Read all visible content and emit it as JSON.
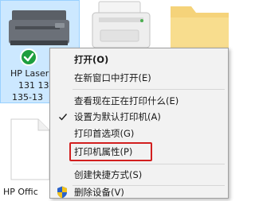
{
  "tiles": {
    "hp": {
      "line1": "HP Laser",
      "line2": "131 13",
      "line3": "135-13"
    },
    "office": {
      "label": "HP Offic"
    }
  },
  "menu": {
    "items": [
      {
        "label": "打开(O)",
        "bold": true
      },
      {
        "label": "在新窗口中打开(E)"
      },
      {
        "label": "查看现在正在打印什么(E)"
      },
      {
        "label": "设置为默认打印机(A)",
        "checked": true
      },
      {
        "label": "打印首选项(G)"
      },
      {
        "label": "打印机属性(P)",
        "highlighted": true
      },
      {
        "label": "创建快捷方式(S)"
      },
      {
        "label": "删除设备(V)",
        "icon": "uac-shield-icon"
      }
    ]
  },
  "colors": {
    "selection_bg": "#cce8ff",
    "menu_bg": "#f2f2f2",
    "highlight_border": "#d21f1f",
    "check_badge": "#1e9e3e"
  }
}
